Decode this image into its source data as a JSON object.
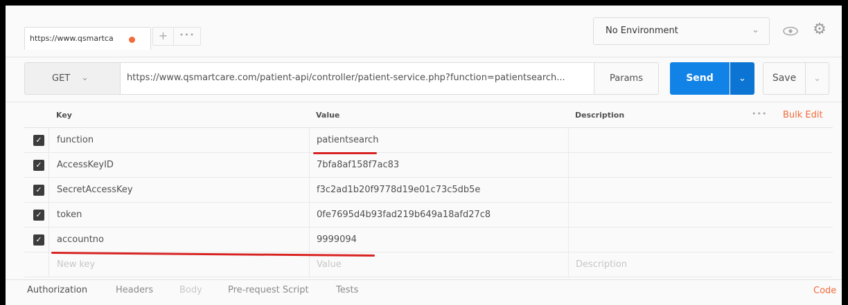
{
  "tabs": [
    {
      "label": "https://www.qsmartca",
      "unsaved": true
    }
  ],
  "environment": {
    "selected": "No Environment"
  },
  "request": {
    "method": "GET",
    "url": "https://www.qsmartcare.com/patient-api/controller/patient-service.php?function=patientsearch...",
    "params_label": "Params",
    "send_label": "Send",
    "save_label": "Save"
  },
  "params_table": {
    "headers": {
      "key": "Key",
      "value": "Value",
      "description": "Description"
    },
    "bulk_edit_label": "Bulk Edit",
    "rows": [
      {
        "checked": true,
        "key": "function",
        "value": "patientsearch",
        "description": ""
      },
      {
        "checked": true,
        "key": "AccessKeyID",
        "value": "7bfa8af158f7ac83",
        "description": ""
      },
      {
        "checked": true,
        "key": "SecretAccessKey",
        "value": "f3c2ad1b20f9778d19e01c73c5db5e",
        "description": ""
      },
      {
        "checked": true,
        "key": "token",
        "value": "0fe7695d4b93fad219b649a18afd27c8",
        "description": ""
      },
      {
        "checked": true,
        "key": "accountno",
        "value": "9999094",
        "description": ""
      }
    ],
    "new_row": {
      "key_placeholder": "New key",
      "value_placeholder": "Value",
      "description_placeholder": "Description"
    }
  },
  "bottom_tabs": [
    {
      "label": "Authorization",
      "state": "active"
    },
    {
      "label": "Headers",
      "state": "normal"
    },
    {
      "label": "Body",
      "state": "disabled"
    },
    {
      "label": "Pre-request Script",
      "state": "normal"
    },
    {
      "label": "Tests",
      "state": "normal"
    }
  ],
  "code_label": "Code",
  "colors": {
    "accent": "#f26b3a",
    "send": "#1183e6",
    "annotation": "#d92323"
  }
}
